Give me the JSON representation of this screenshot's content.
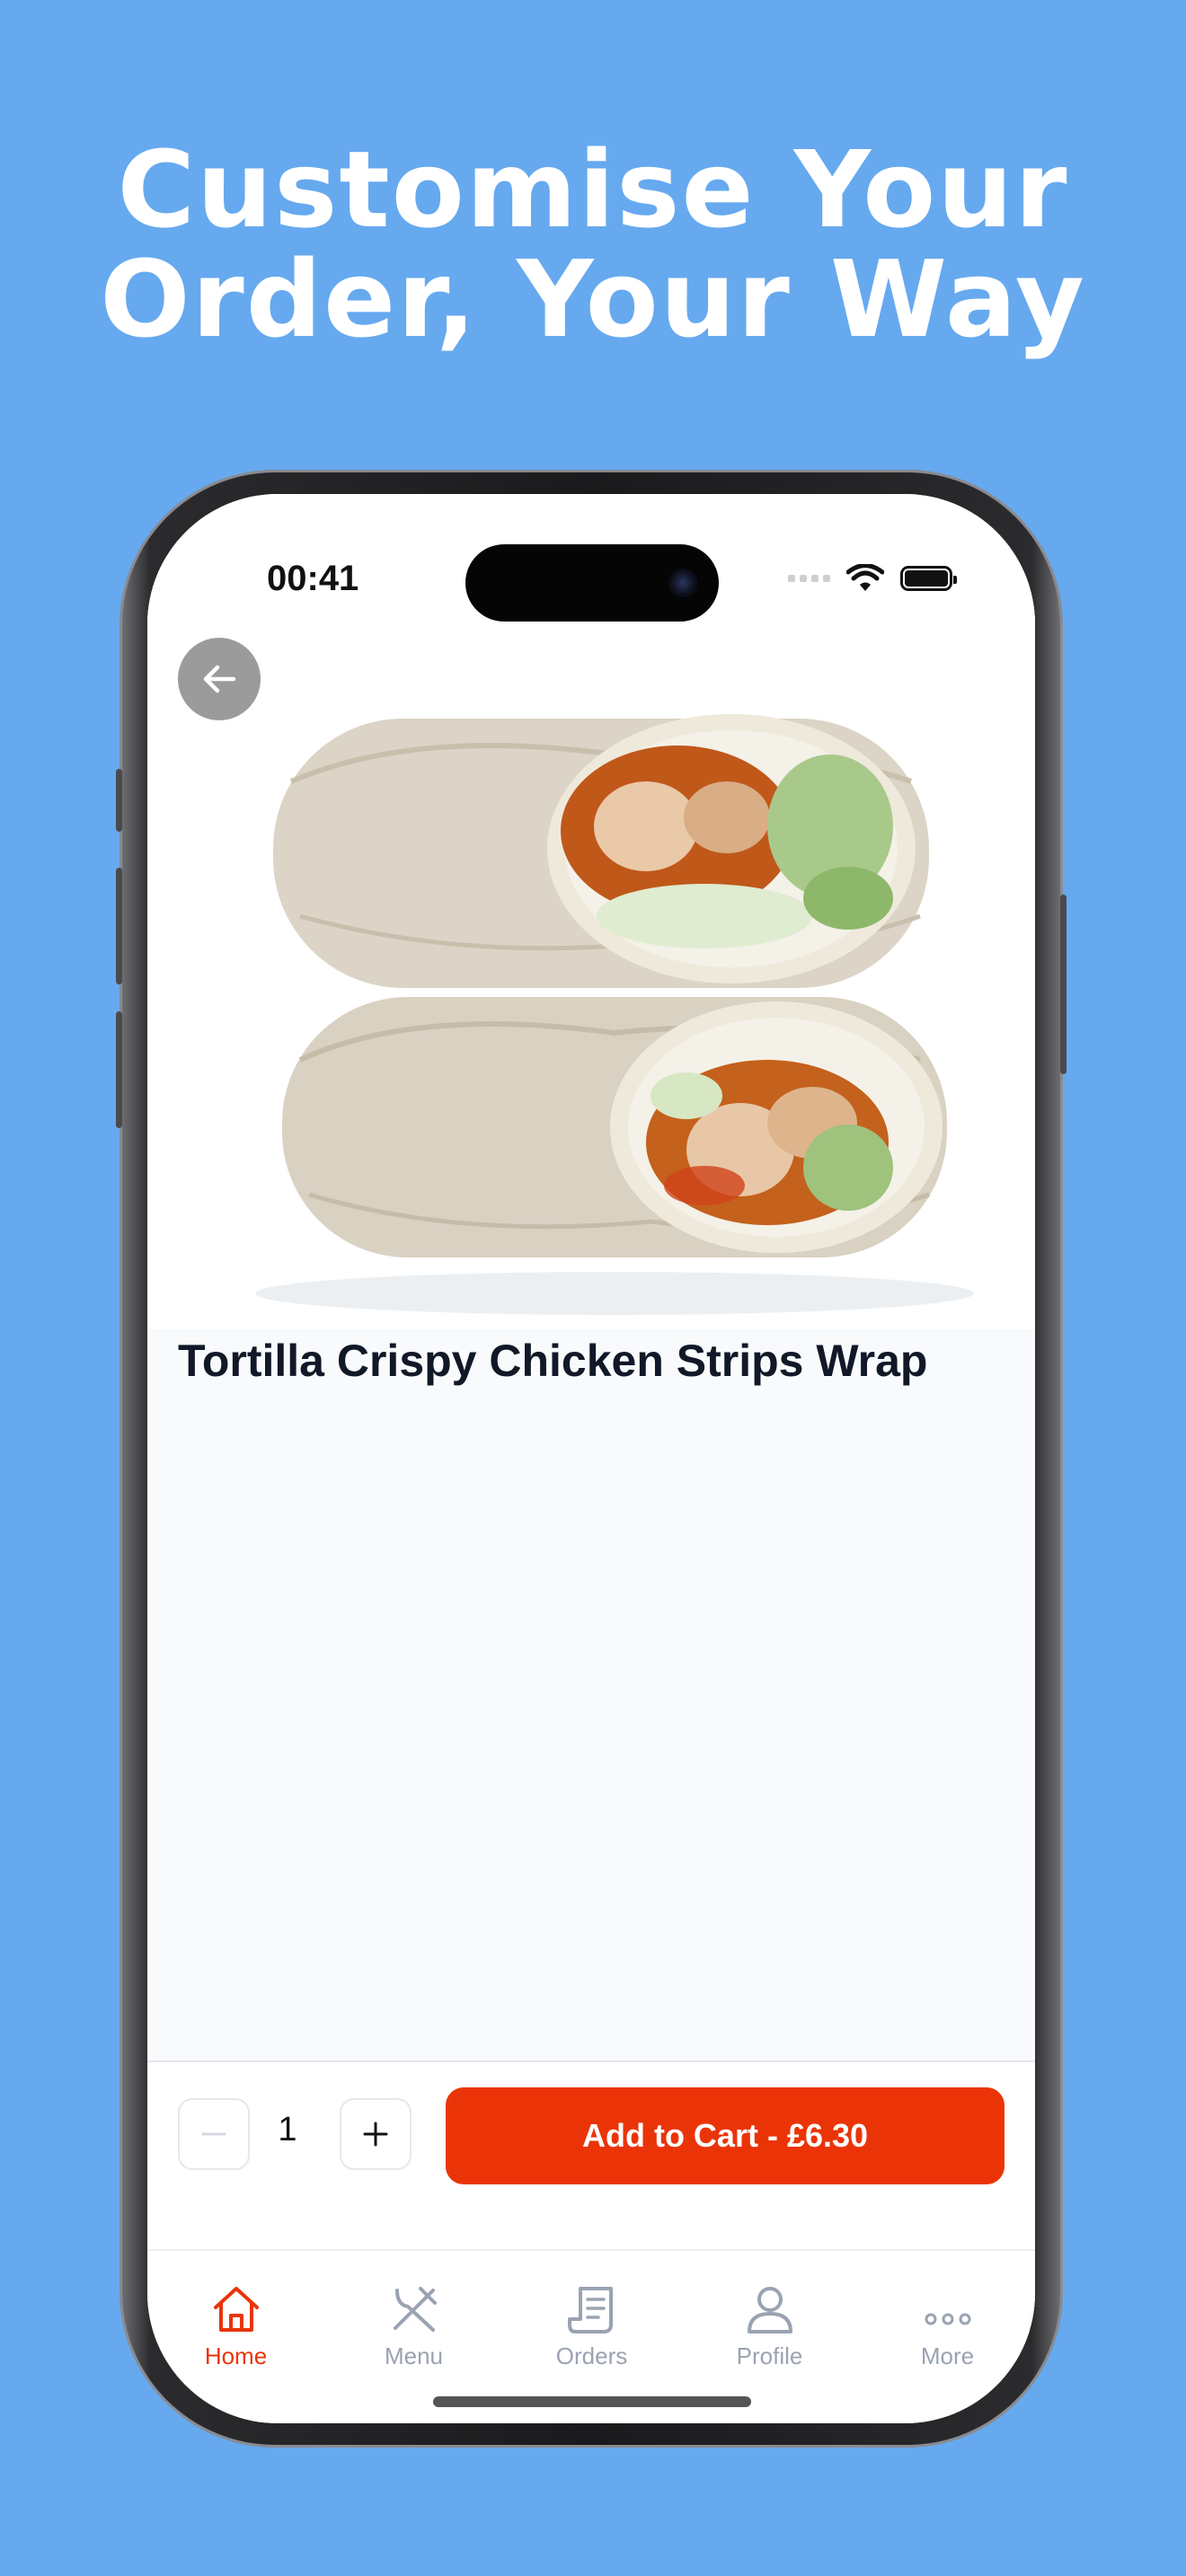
{
  "headline": {
    "line1": "Customise Your",
    "line2": "Order, Your Way"
  },
  "status_bar": {
    "time": "00:41"
  },
  "product": {
    "title": "Tortilla Crispy Chicken Strips Wrap"
  },
  "cart": {
    "quantity": "1",
    "add_button_label": "Add to Cart - £6.30"
  },
  "tabs": [
    {
      "label": "Home",
      "icon": "home-icon",
      "active": true
    },
    {
      "label": "Menu",
      "icon": "utensils-icon",
      "active": false
    },
    {
      "label": "Orders",
      "icon": "receipt-icon",
      "active": false
    },
    {
      "label": "Profile",
      "icon": "user-icon",
      "active": false
    },
    {
      "label": "More",
      "icon": "more-icon",
      "active": false
    }
  ],
  "colors": {
    "background": "#66a9ef",
    "accent": "#ea3408",
    "inactive_tab": "#9aa3b2"
  }
}
